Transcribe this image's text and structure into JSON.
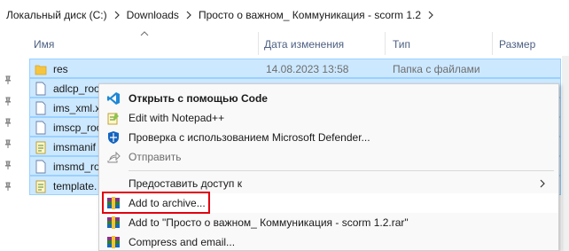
{
  "breadcrumb": {
    "items": [
      "Локальный диск (C:)",
      "Downloads",
      "Просто о важном_ Коммуникация - scorm 1.2"
    ]
  },
  "columns": {
    "name": "Имя",
    "date": "Дата изменения",
    "type": "Тип",
    "size": "Размер"
  },
  "files": [
    {
      "name": "res",
      "date": "14.08.2023 13:58",
      "type": "Папка с файлами",
      "icon": "folder-icon"
    },
    {
      "name": "adlcp_roo",
      "date": "",
      "type": "",
      "icon": "xsd-file-icon"
    },
    {
      "name": "ims_xml.x",
      "date": "",
      "type": "",
      "icon": "xsd-file-icon"
    },
    {
      "name": "imscp_roo",
      "date": "",
      "type": "",
      "icon": "xsd-file-icon"
    },
    {
      "name": "imsmanif",
      "date": "",
      "type": "",
      "icon": "xml-notepad-icon"
    },
    {
      "name": "imsmd_ro",
      "date": "",
      "type": "",
      "icon": "xsd-file-icon"
    },
    {
      "name": "template.",
      "date": "",
      "type": "",
      "icon": "xml-notepad-icon"
    }
  ],
  "context_menu": {
    "items": [
      {
        "label": "Открыть с помощью Code",
        "icon": "vscode-icon"
      },
      {
        "label": "Edit with Notepad++",
        "icon": "notepadpp-icon"
      },
      {
        "label": "Проверка с использованием Microsoft Defender...",
        "icon": "defender-shield-icon"
      },
      {
        "label": "Отправить",
        "icon": "share-icon"
      },
      {
        "label": "Предоставить доступ к",
        "icon": ""
      },
      {
        "label": "Add to archive...",
        "icon": "winrar-icon"
      },
      {
        "label": "Add to \"Просто о важном_ Коммуникация - scorm 1.2.rar\"",
        "icon": "winrar-icon"
      },
      {
        "label": "Compress and email...",
        "icon": "winrar-icon"
      }
    ]
  },
  "colors": {
    "selection_bg": "#cce8ff",
    "selection_border": "#99d1ff",
    "highlight_box": "#e0000f",
    "header_text": "#4d6082"
  }
}
